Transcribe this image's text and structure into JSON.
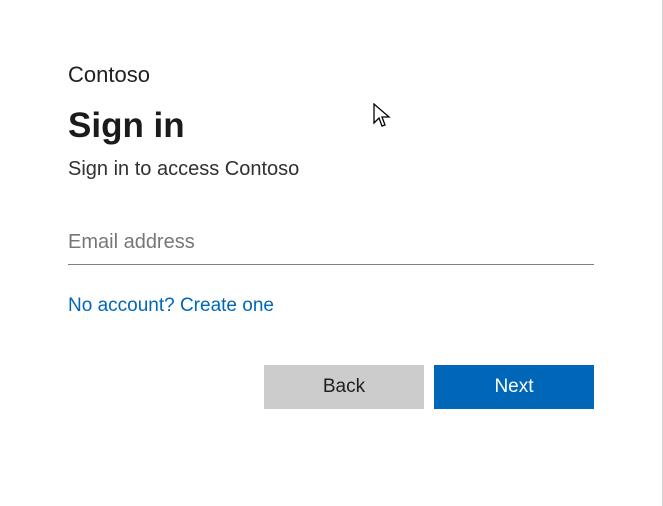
{
  "brand": "Contoso",
  "title": "Sign in",
  "subtitle": "Sign in to access Contoso",
  "email": {
    "placeholder": "Email address",
    "value": ""
  },
  "links": {
    "create_account": "No account? Create one"
  },
  "buttons": {
    "back": "Back",
    "next": "Next"
  }
}
